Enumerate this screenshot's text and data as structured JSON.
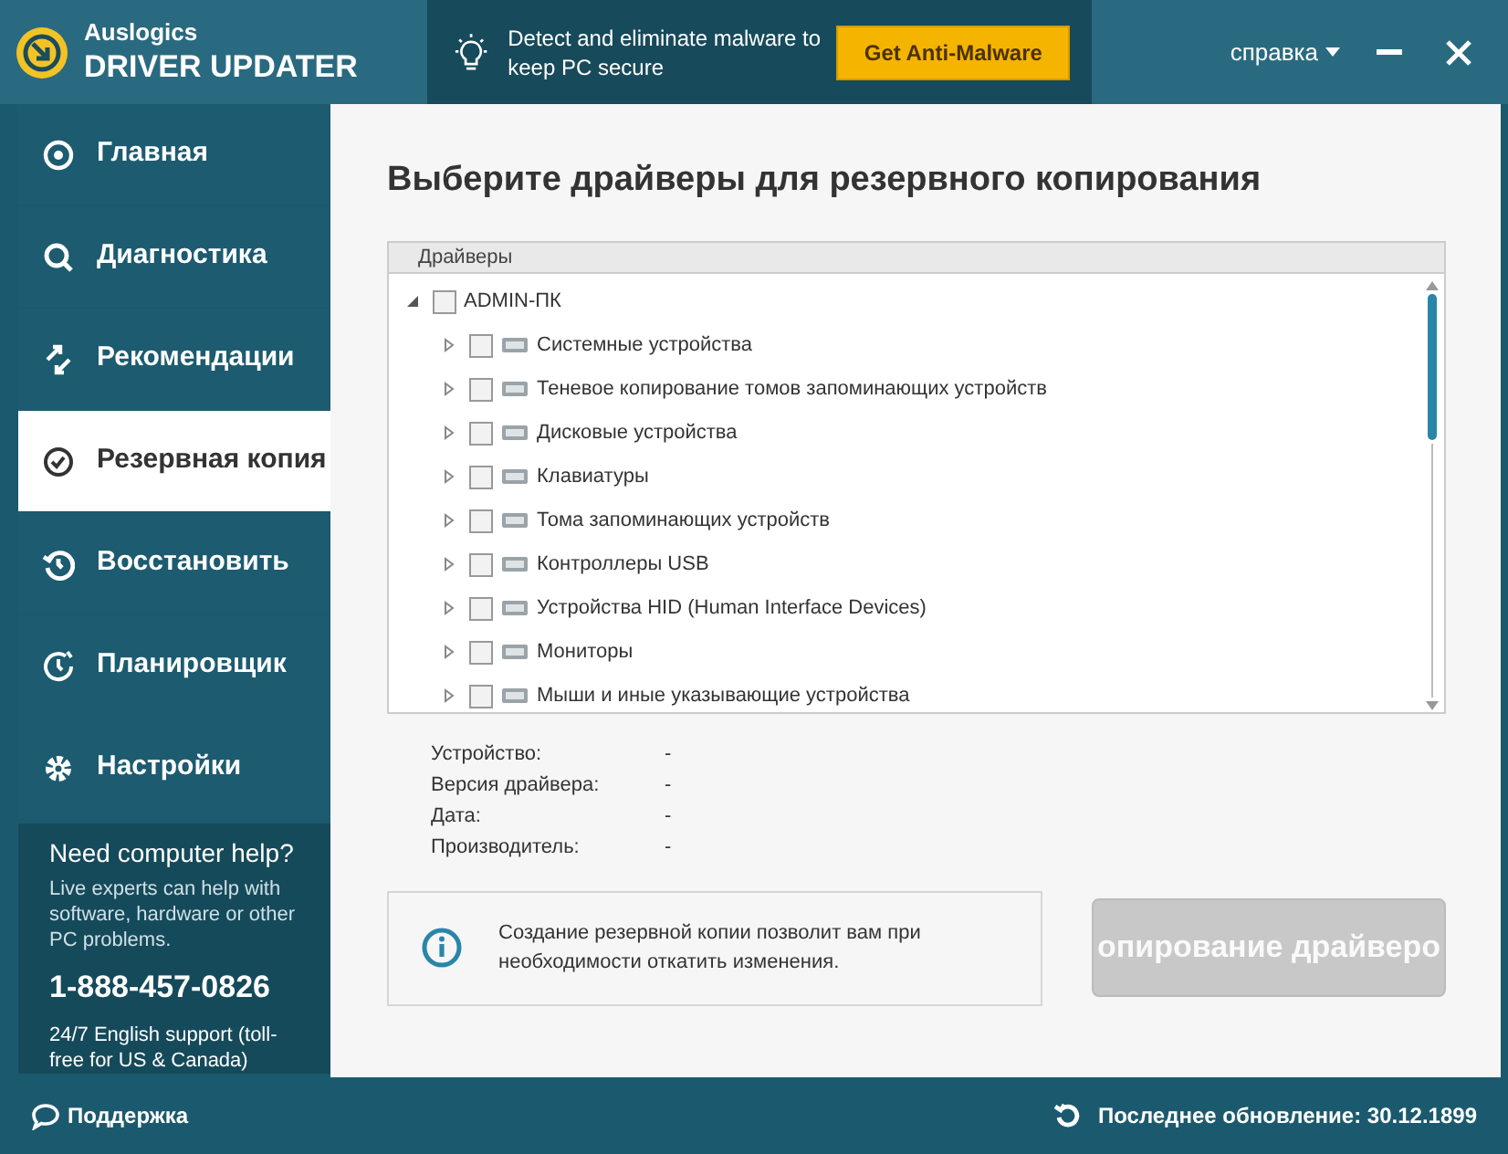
{
  "app": {
    "brand": "Auslogics",
    "product": "DRIVER UPDATER"
  },
  "promo": {
    "text": "Detect and eliminate malware to keep PC secure",
    "button": "Get Anti-Malware"
  },
  "header": {
    "help_menu": "справка"
  },
  "sidebar": {
    "items": [
      {
        "label": "Главная",
        "selected": false
      },
      {
        "label": "Диагностика",
        "selected": false
      },
      {
        "label": "Рекомендации",
        "selected": false
      },
      {
        "label": "Резервная копия",
        "selected": true
      },
      {
        "label": "Восстановить",
        "selected": false
      },
      {
        "label": "Планировщик",
        "selected": false
      },
      {
        "label": "Настройки",
        "selected": false
      }
    ]
  },
  "help_box": {
    "title": "Need computer help?",
    "text": "Live experts can help with software, hardware or other PC problems.",
    "phone": "1-888-457-0826",
    "note": "24/7 English support (toll-free for US & Canada)"
  },
  "page": {
    "title": "Выберите драйверы для резервного копирования"
  },
  "tree": {
    "column": "Драйверы",
    "root": {
      "label": "ADMIN-ПК",
      "checked": false,
      "expanded": true,
      "children": [
        {
          "label": "Системные устройства",
          "checked": false,
          "expanded": false
        },
        {
          "label": "Теневое копирование томов запоминающих устройств",
          "checked": false,
          "expanded": false
        },
        {
          "label": "Дисковые устройства",
          "checked": false,
          "expanded": false
        },
        {
          "label": "Клавиатуры",
          "checked": false,
          "expanded": false
        },
        {
          "label": "Тома запоминающих устройств",
          "checked": false,
          "expanded": false
        },
        {
          "label": "Контроллеры USB",
          "checked": false,
          "expanded": false
        },
        {
          "label": "Устройства HID (Human Interface Devices)",
          "checked": false,
          "expanded": false
        },
        {
          "label": "Мониторы",
          "checked": false,
          "expanded": false
        },
        {
          "label": "Мыши и иные указывающие устройства",
          "checked": false,
          "expanded": false
        }
      ]
    }
  },
  "details": [
    {
      "label": "Устройство:",
      "value": "-"
    },
    {
      "label": "Версия драйвера:",
      "value": "-"
    },
    {
      "label": "Дата:",
      "value": "-"
    },
    {
      "label": "Производитель:",
      "value": "-"
    }
  ],
  "info": {
    "text": "Создание резервной копии позволит вам при необходимости откатить изменения."
  },
  "backup_button": {
    "label": "опирование драйверо",
    "disabled": true
  },
  "footer": {
    "support": "Поддержка",
    "last_update": "Последнее обновление: 30.12.1899"
  }
}
